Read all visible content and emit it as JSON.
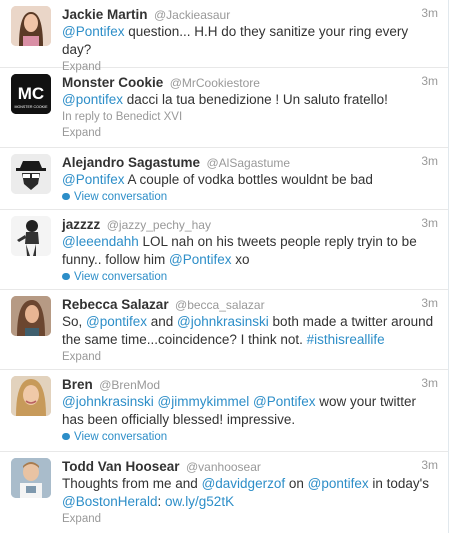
{
  "colors": {
    "link": "#2d8ec8",
    "muted": "#999999",
    "text": "#333333"
  },
  "tweets": [
    {
      "name": "Jackie Martin",
      "handle": "@Jackieasaur",
      "time": "3m",
      "segments": [
        {
          "t": "@Pontifex",
          "k": "mention"
        },
        {
          "t": " question... H.H do they sanitize your ring every day?",
          "k": "text"
        }
      ],
      "action": "Expand",
      "action_type": "expand"
    },
    {
      "name": "Monster Cookie",
      "handle": "@MrCookiestore",
      "time": "3m",
      "segments": [
        {
          "t": "@pontifex",
          "k": "mention"
        },
        {
          "t": " dacci la tua benedizione ! Un saluto fratello!",
          "k": "text"
        }
      ],
      "reply_to": "In reply to Benedict XVI",
      "action": "Expand",
      "action_type": "expand",
      "avatar_text": "MC",
      "avatar_subtext": "MONSTER COOKIE"
    },
    {
      "name": "Alejandro Sagastume",
      "handle": "@AlSagastume",
      "time": "3m",
      "segments": [
        {
          "t": "@Pontifex",
          "k": "mention"
        },
        {
          "t": " A couple of vodka bottles wouldnt be bad",
          "k": "text"
        }
      ],
      "action": "View conversation",
      "action_type": "conversation"
    },
    {
      "name": "jazzzz",
      "handle": "@jazzy_pechy_hay",
      "time": "3m",
      "segments": [
        {
          "t": "@leeendahh",
          "k": "mention"
        },
        {
          "t": " LOL nah on his tweets people reply tryin to be funny.. follow him ",
          "k": "text"
        },
        {
          "t": "@Pontifex",
          "k": "mention"
        },
        {
          "t": " xo",
          "k": "text"
        }
      ],
      "action": "View conversation",
      "action_type": "conversation"
    },
    {
      "name": "Rebecca Salazar",
      "handle": "@becca_salazar",
      "time": "3m",
      "segments": [
        {
          "t": "So, ",
          "k": "text"
        },
        {
          "t": "@pontifex",
          "k": "mention"
        },
        {
          "t": " and ",
          "k": "text"
        },
        {
          "t": "@johnkrasinski",
          "k": "mention"
        },
        {
          "t": " both made a twitter around the same time...coincidence? I think not. ",
          "k": "text"
        },
        {
          "t": "#isthisreallife",
          "k": "hashtag"
        }
      ],
      "action": "Expand",
      "action_type": "expand"
    },
    {
      "name": "Bren",
      "handle": "@BrenMod",
      "time": "3m",
      "segments": [
        {
          "t": "@johnkrasinski",
          "k": "mention"
        },
        {
          "t": " ",
          "k": "text"
        },
        {
          "t": "@jimmykimmel",
          "k": "mention"
        },
        {
          "t": " ",
          "k": "text"
        },
        {
          "t": "@Pontifex",
          "k": "mention"
        },
        {
          "t": " wow your twitter has been officially blessed! impressive.",
          "k": "text"
        }
      ],
      "action": "View conversation",
      "action_type": "conversation"
    },
    {
      "name": "Todd Van Hoosear",
      "handle": "@vanhoosear",
      "time": "3m",
      "segments": [
        {
          "t": "Thoughts from me and ",
          "k": "text"
        },
        {
          "t": "@davidgerzof",
          "k": "mention"
        },
        {
          "t": " on ",
          "k": "text"
        },
        {
          "t": "@pontifex",
          "k": "mention"
        },
        {
          "t": " in today's ",
          "k": "text"
        },
        {
          "t": "@BostonHerald",
          "k": "mention"
        },
        {
          "t": ": ",
          "k": "text"
        },
        {
          "t": "ow.ly/g52tK",
          "k": "link"
        }
      ],
      "action": "Expand",
      "action_type": "expand"
    }
  ]
}
